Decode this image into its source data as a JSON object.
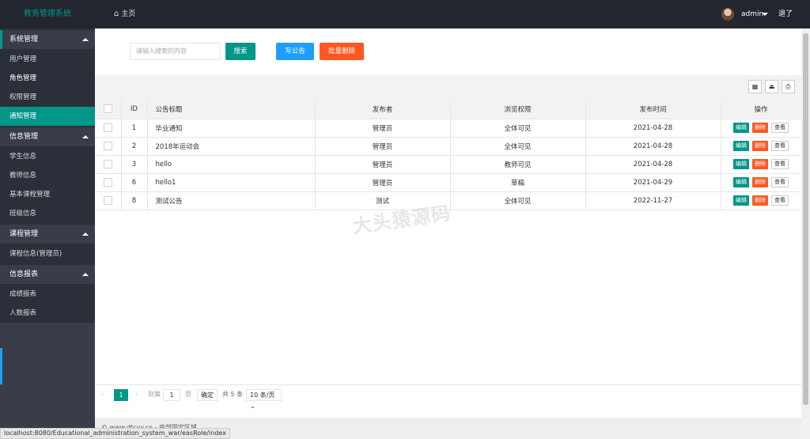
{
  "header": {
    "app_title": "教务管理系统",
    "home_label": "主页",
    "home_icon": "home-icon",
    "username": "admin",
    "logout_label": "退了"
  },
  "sidebar": {
    "groups": [
      {
        "label": "系统管理",
        "items": [
          "用户管理",
          "角色管理",
          "权限管理",
          "通知管理"
        ]
      },
      {
        "label": "信息管理",
        "items": [
          "学生信息",
          "教师信息",
          "基本课程管理",
          "班级信息"
        ]
      },
      {
        "label": "课程管理",
        "items": [
          "课程信息(管理员)"
        ]
      },
      {
        "label": "信息报表",
        "items": [
          "成绩报表",
          "人数报表"
        ]
      }
    ],
    "selected_item": "通知管理",
    "accent_color": "#009688"
  },
  "search": {
    "placeholder": "请输入搜索的内容",
    "search_label": "搜索",
    "notice_label": "写公告",
    "batch_delete_label": "批量删除"
  },
  "toolbar": {
    "icons": [
      "columns-icon",
      "export-icon",
      "print-icon"
    ]
  },
  "table": {
    "headers": [
      "ID",
      "公告标题",
      "发布者",
      "浏览权限",
      "发布时间",
      "操作"
    ],
    "rows": [
      {
        "id": "1",
        "title": "毕业通知",
        "publisher": "管理员",
        "permission": "全体可见",
        "time": "2021-04-28"
      },
      {
        "id": "2",
        "title": "2018年运动会",
        "publisher": "管理员",
        "permission": "全体可见",
        "time": "2021-04-28"
      },
      {
        "id": "3",
        "title": "hello",
        "publisher": "管理员",
        "permission": "教师可见",
        "time": "2021-04-28"
      },
      {
        "id": "6",
        "title": "hello1",
        "publisher": "管理员",
        "permission": "草稿",
        "time": "2021-04-29"
      },
      {
        "id": "8",
        "title": "测试公告",
        "publisher": "测试",
        "permission": "全体可见",
        "time": "2022-11-27"
      }
    ],
    "actions": {
      "edit": "编辑",
      "delete": "删除",
      "view": "查看"
    }
  },
  "watermark": "大头猿源码",
  "pager": {
    "current_page": "1",
    "goto_label": "到第",
    "goto_value": "1",
    "page_unit": "页",
    "confirm_label": "确定",
    "total_label": "共 5 条",
    "page_size": "10 条/页"
  },
  "footer": {
    "text": "© www.dtcyy.cn - 底部固定区域"
  },
  "status_url": "localhost:8080/Educational_administration_system_war/easRole/index"
}
